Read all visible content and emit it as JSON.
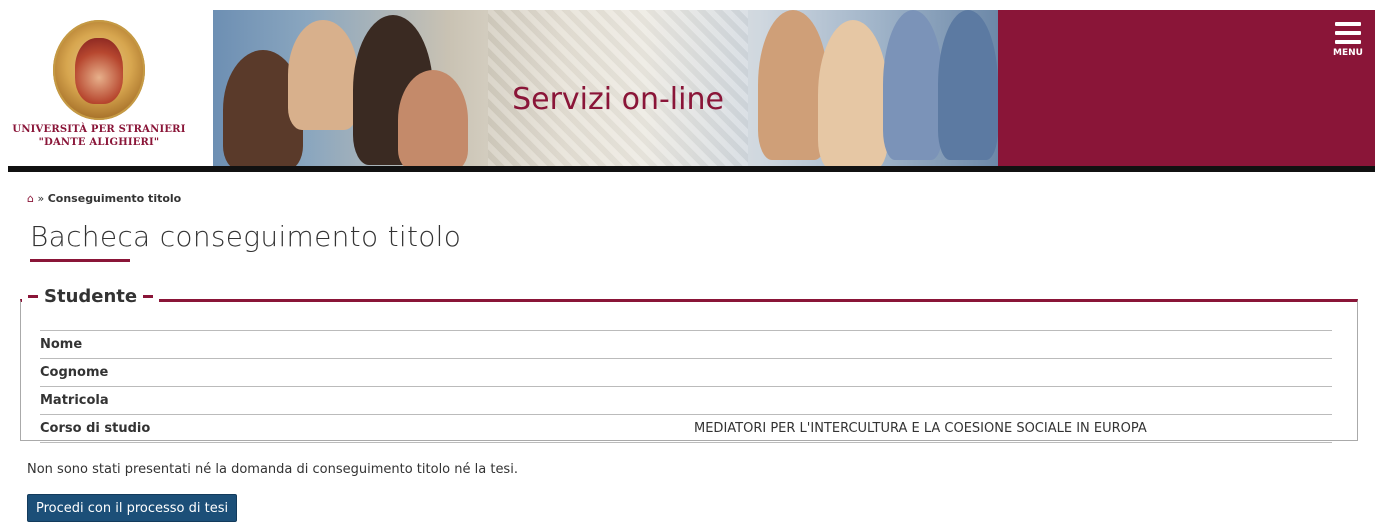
{
  "header": {
    "university_name_line1": "UNIVERSITÀ PER STRANIERI",
    "university_name_line2": "\"DANTE ALIGHIERI\"",
    "site_title": "Servizi on-line",
    "menu_label": "MENU",
    "brand_color": "#8a1538"
  },
  "breadcrumb": {
    "home_icon": "home-icon",
    "separator": "»",
    "current": "Conseguimento titolo"
  },
  "page": {
    "title": "Bacheca conseguimento titolo"
  },
  "student": {
    "legend": "Studente",
    "rows": [
      {
        "label": "Nome",
        "value": ""
      },
      {
        "label": "Cognome",
        "value": ""
      },
      {
        "label": "Matricola",
        "value": ""
      },
      {
        "label": "Corso di studio",
        "value": "MEDIATORI PER L'INTERCULTURA E LA COESIONE SOCIALE IN EUROPA"
      }
    ]
  },
  "notice": "Non sono stati presentati né la domanda di conseguimento titolo né la tesi.",
  "actions": {
    "proceed_label": "Procedi con il processo di tesi",
    "button_color": "#1c4f78"
  }
}
